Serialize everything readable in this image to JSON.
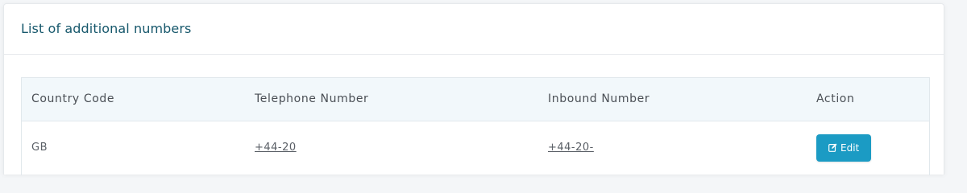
{
  "panel": {
    "title": "List of additional numbers"
  },
  "table": {
    "headers": {
      "country_code": "Country Code",
      "telephone_number": "Telephone Number",
      "inbound_number": "Inbound Number",
      "action": "Action"
    },
    "rows": [
      {
        "country_code": "GB",
        "telephone_number": "+44-20",
        "inbound_number": "+44-20-",
        "action_label": "Edit",
        "action_icon": "edit-icon"
      }
    ]
  },
  "colors": {
    "title": "#17586c",
    "header_bg": "#f2f8fb",
    "edit_button_bg": "#1b9bc4"
  }
}
